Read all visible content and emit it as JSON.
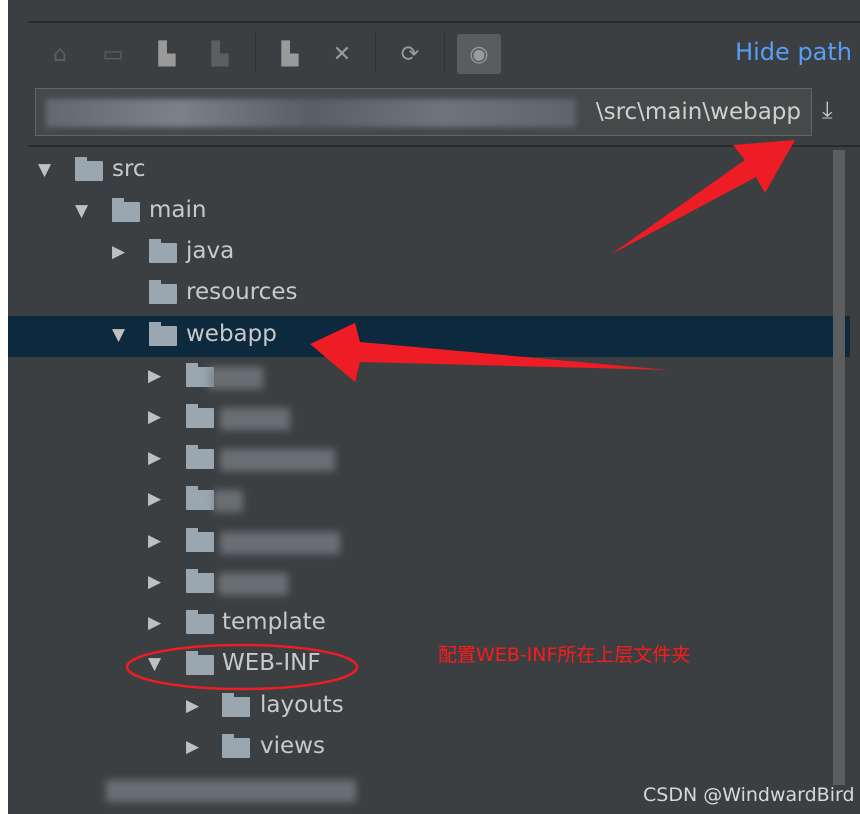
{
  "toolbar": {
    "icons": [
      "home-icon",
      "desktop-icon",
      "project-folder-icon",
      "module-folder-icon",
      "new-folder-icon",
      "delete-icon",
      "refresh-icon",
      "show-hidden-icon"
    ],
    "hide_path": "Hide path"
  },
  "path": {
    "value": "\\src\\main\\webapp"
  },
  "tree": {
    "src": "src",
    "main": "main",
    "java": "java",
    "resources": "resources",
    "webapp": "webapp",
    "template": "template",
    "webinf": "WEB-INF",
    "layouts": "layouts",
    "views": "views"
  },
  "annotation": {
    "note": "配置WEB-INF所在上层文件夹",
    "color": "#ff1a1a"
  },
  "watermark": "CSDN @WindwardBird",
  "colors": {
    "background": "#3c3f41",
    "selection": "#0d293e",
    "link": "#589df6"
  }
}
